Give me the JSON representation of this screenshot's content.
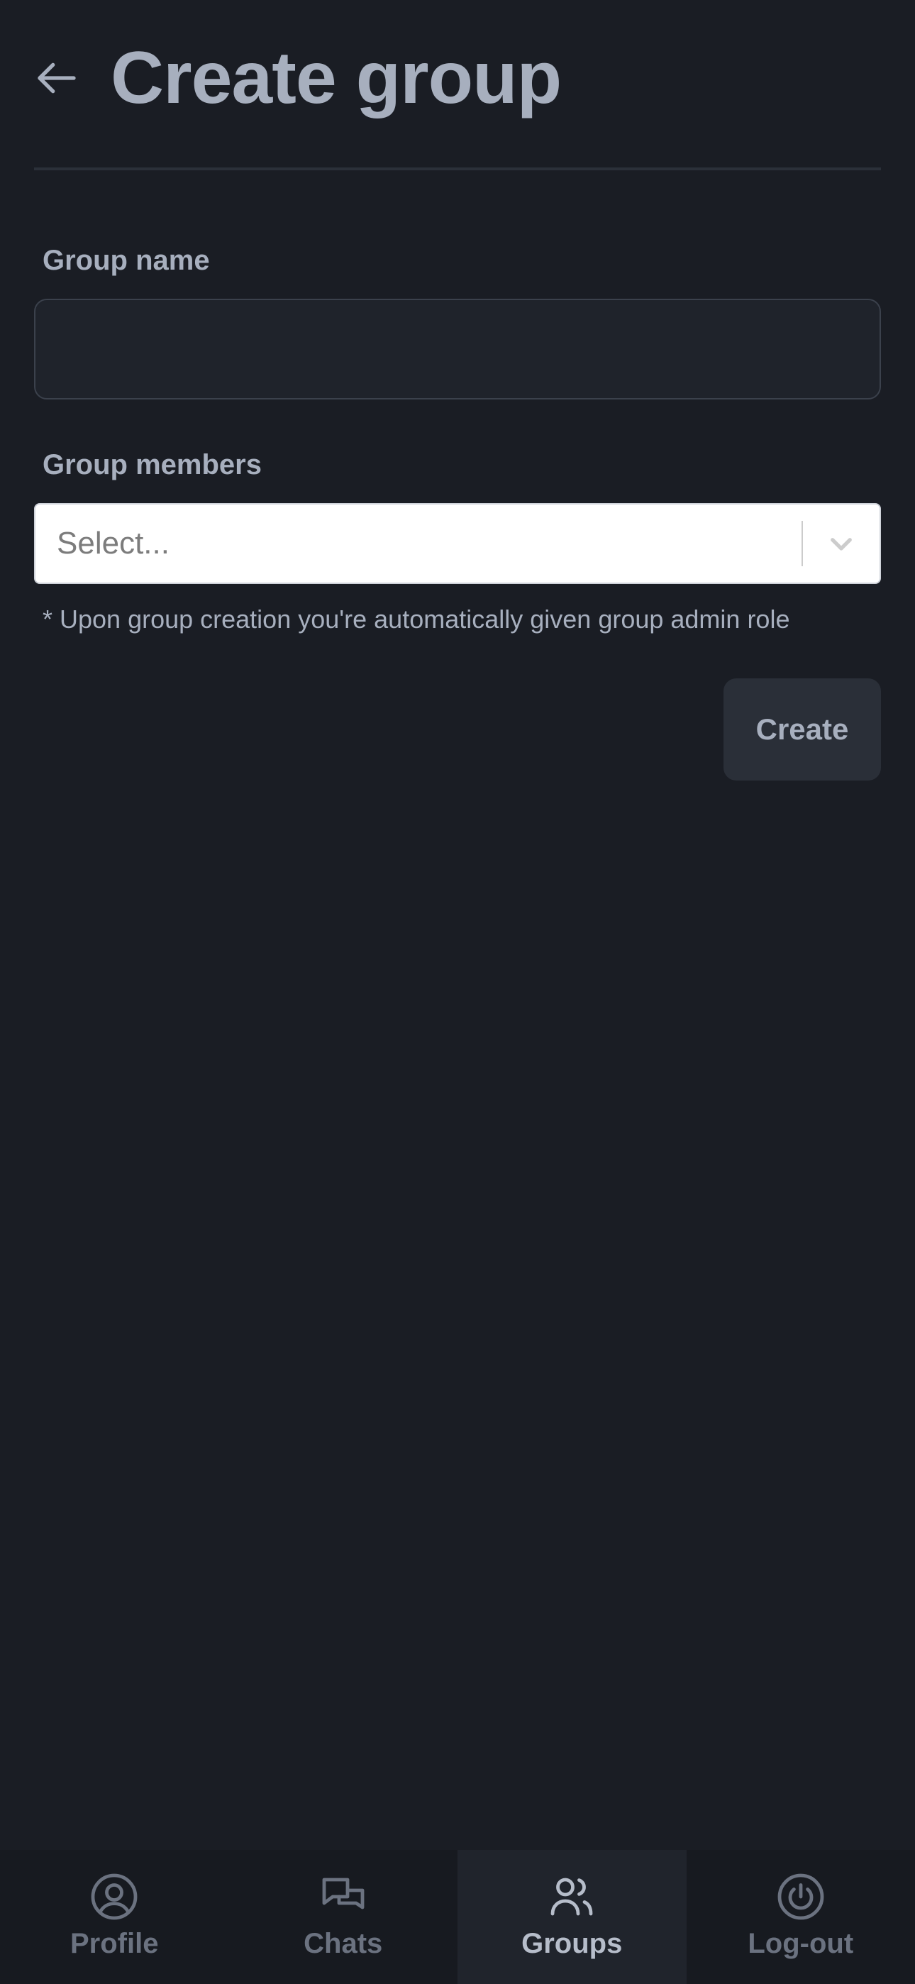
{
  "header": {
    "back_icon": "arrow-left-icon",
    "title": "Create group"
  },
  "form": {
    "group_name": {
      "label": "Group name",
      "value": "",
      "placeholder": ""
    },
    "group_members": {
      "label": "Group members",
      "placeholder": "Select...",
      "indicator_icon": "chevron-down-icon"
    },
    "hint": "* Upon group creation you're automatically given group admin role",
    "create_label": "Create"
  },
  "nav": {
    "items": [
      {
        "label": "Profile",
        "icon": "user-circle-icon",
        "active": false
      },
      {
        "label": "Chats",
        "icon": "chat-bubbles-icon",
        "active": false
      },
      {
        "label": "Groups",
        "icon": "users-icon",
        "active": true
      },
      {
        "label": "Log-out",
        "icon": "power-icon",
        "active": false
      }
    ]
  },
  "colors": {
    "background": "#1a1d24",
    "text": "#a7afbe",
    "nav_inactive": "#6b7280",
    "nav_active_bg": "#20242c"
  }
}
